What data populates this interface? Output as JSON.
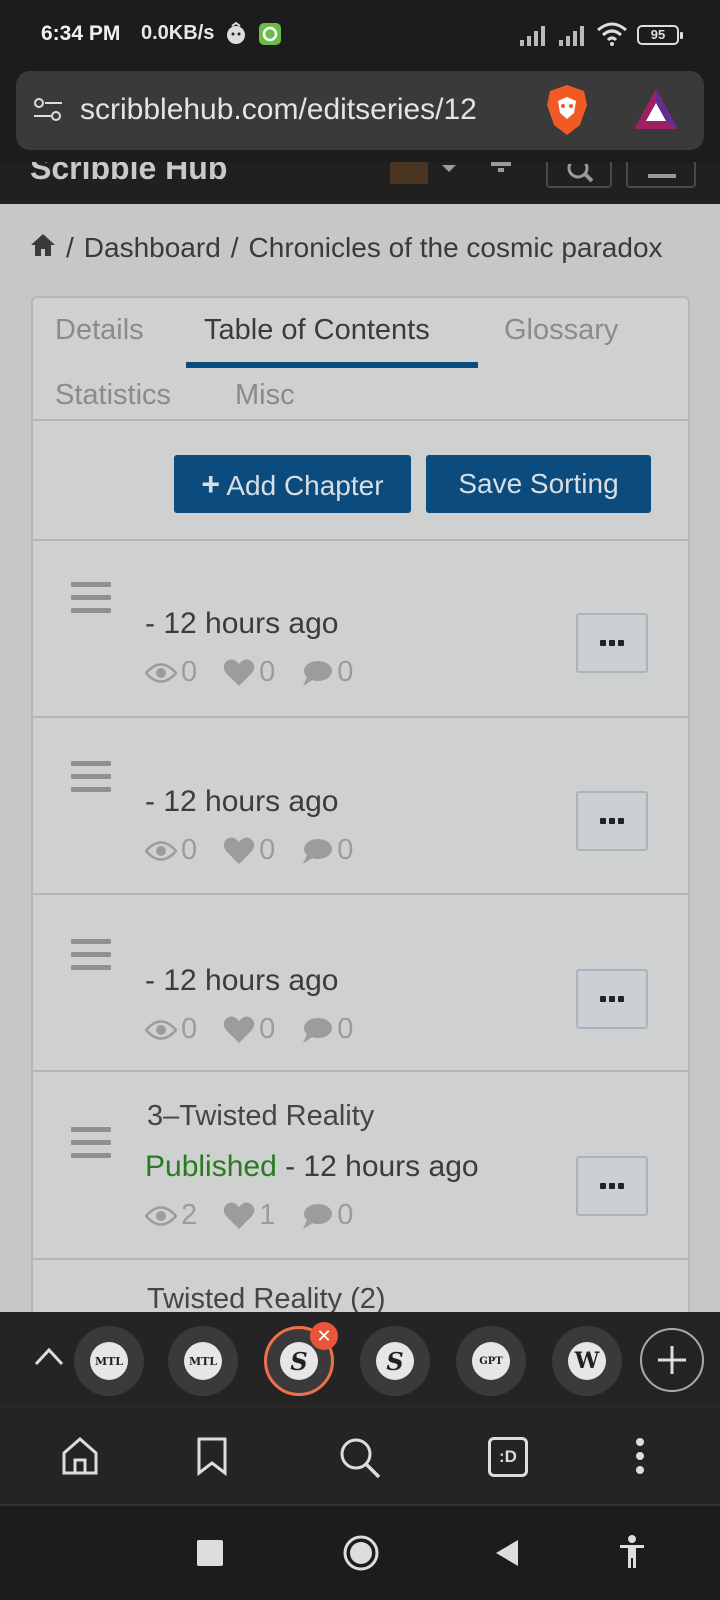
{
  "status_bar": {
    "time": "6:34 PM",
    "speed": "0.0KB/s",
    "battery": "95"
  },
  "browser": {
    "url": "scribblehub.com/editseries/12",
    "tab_close_label": "✕"
  },
  "site": {
    "title": "Scribble Hub"
  },
  "breadcrumb": {
    "sep": "/",
    "dashboard": "Dashboard",
    "series": "Chronicles of the cosmic paradox"
  },
  "tabs": [
    {
      "label": "Details"
    },
    {
      "label": "Table of Contents"
    },
    {
      "label": "Glossary"
    },
    {
      "label": "Statistics"
    },
    {
      "label": "Misc"
    }
  ],
  "actions": {
    "add_chapter": "Add Chapter",
    "add_chapter_icon": "+",
    "save_sorting": "Save Sorting"
  },
  "chapters": [
    {
      "title": "",
      "status": "",
      "time": "- 12 hours ago",
      "views": "0",
      "likes": "0",
      "comments": "0"
    },
    {
      "title": "",
      "status": "",
      "time": "- 12 hours ago",
      "views": "0",
      "likes": "0",
      "comments": "0"
    },
    {
      "title": "",
      "status": "",
      "time": "- 12 hours ago",
      "views": "0",
      "likes": "0",
      "comments": "0"
    },
    {
      "title": "3–Twisted Reality",
      "status": "Published",
      "time": " - 12 hours ago",
      "views": "2",
      "likes": "1",
      "comments": "0"
    },
    {
      "title": "Twisted Reality (2)"
    }
  ],
  "tab_strip": {
    "thumbs": [
      "MTL",
      "MTL",
      "S",
      "S",
      "GPT",
      "W"
    ]
  },
  "toolbar": {
    "tabs_label": ":D"
  },
  "colors": {
    "accent": "#0c4b7d",
    "published": "#2a7a21"
  }
}
